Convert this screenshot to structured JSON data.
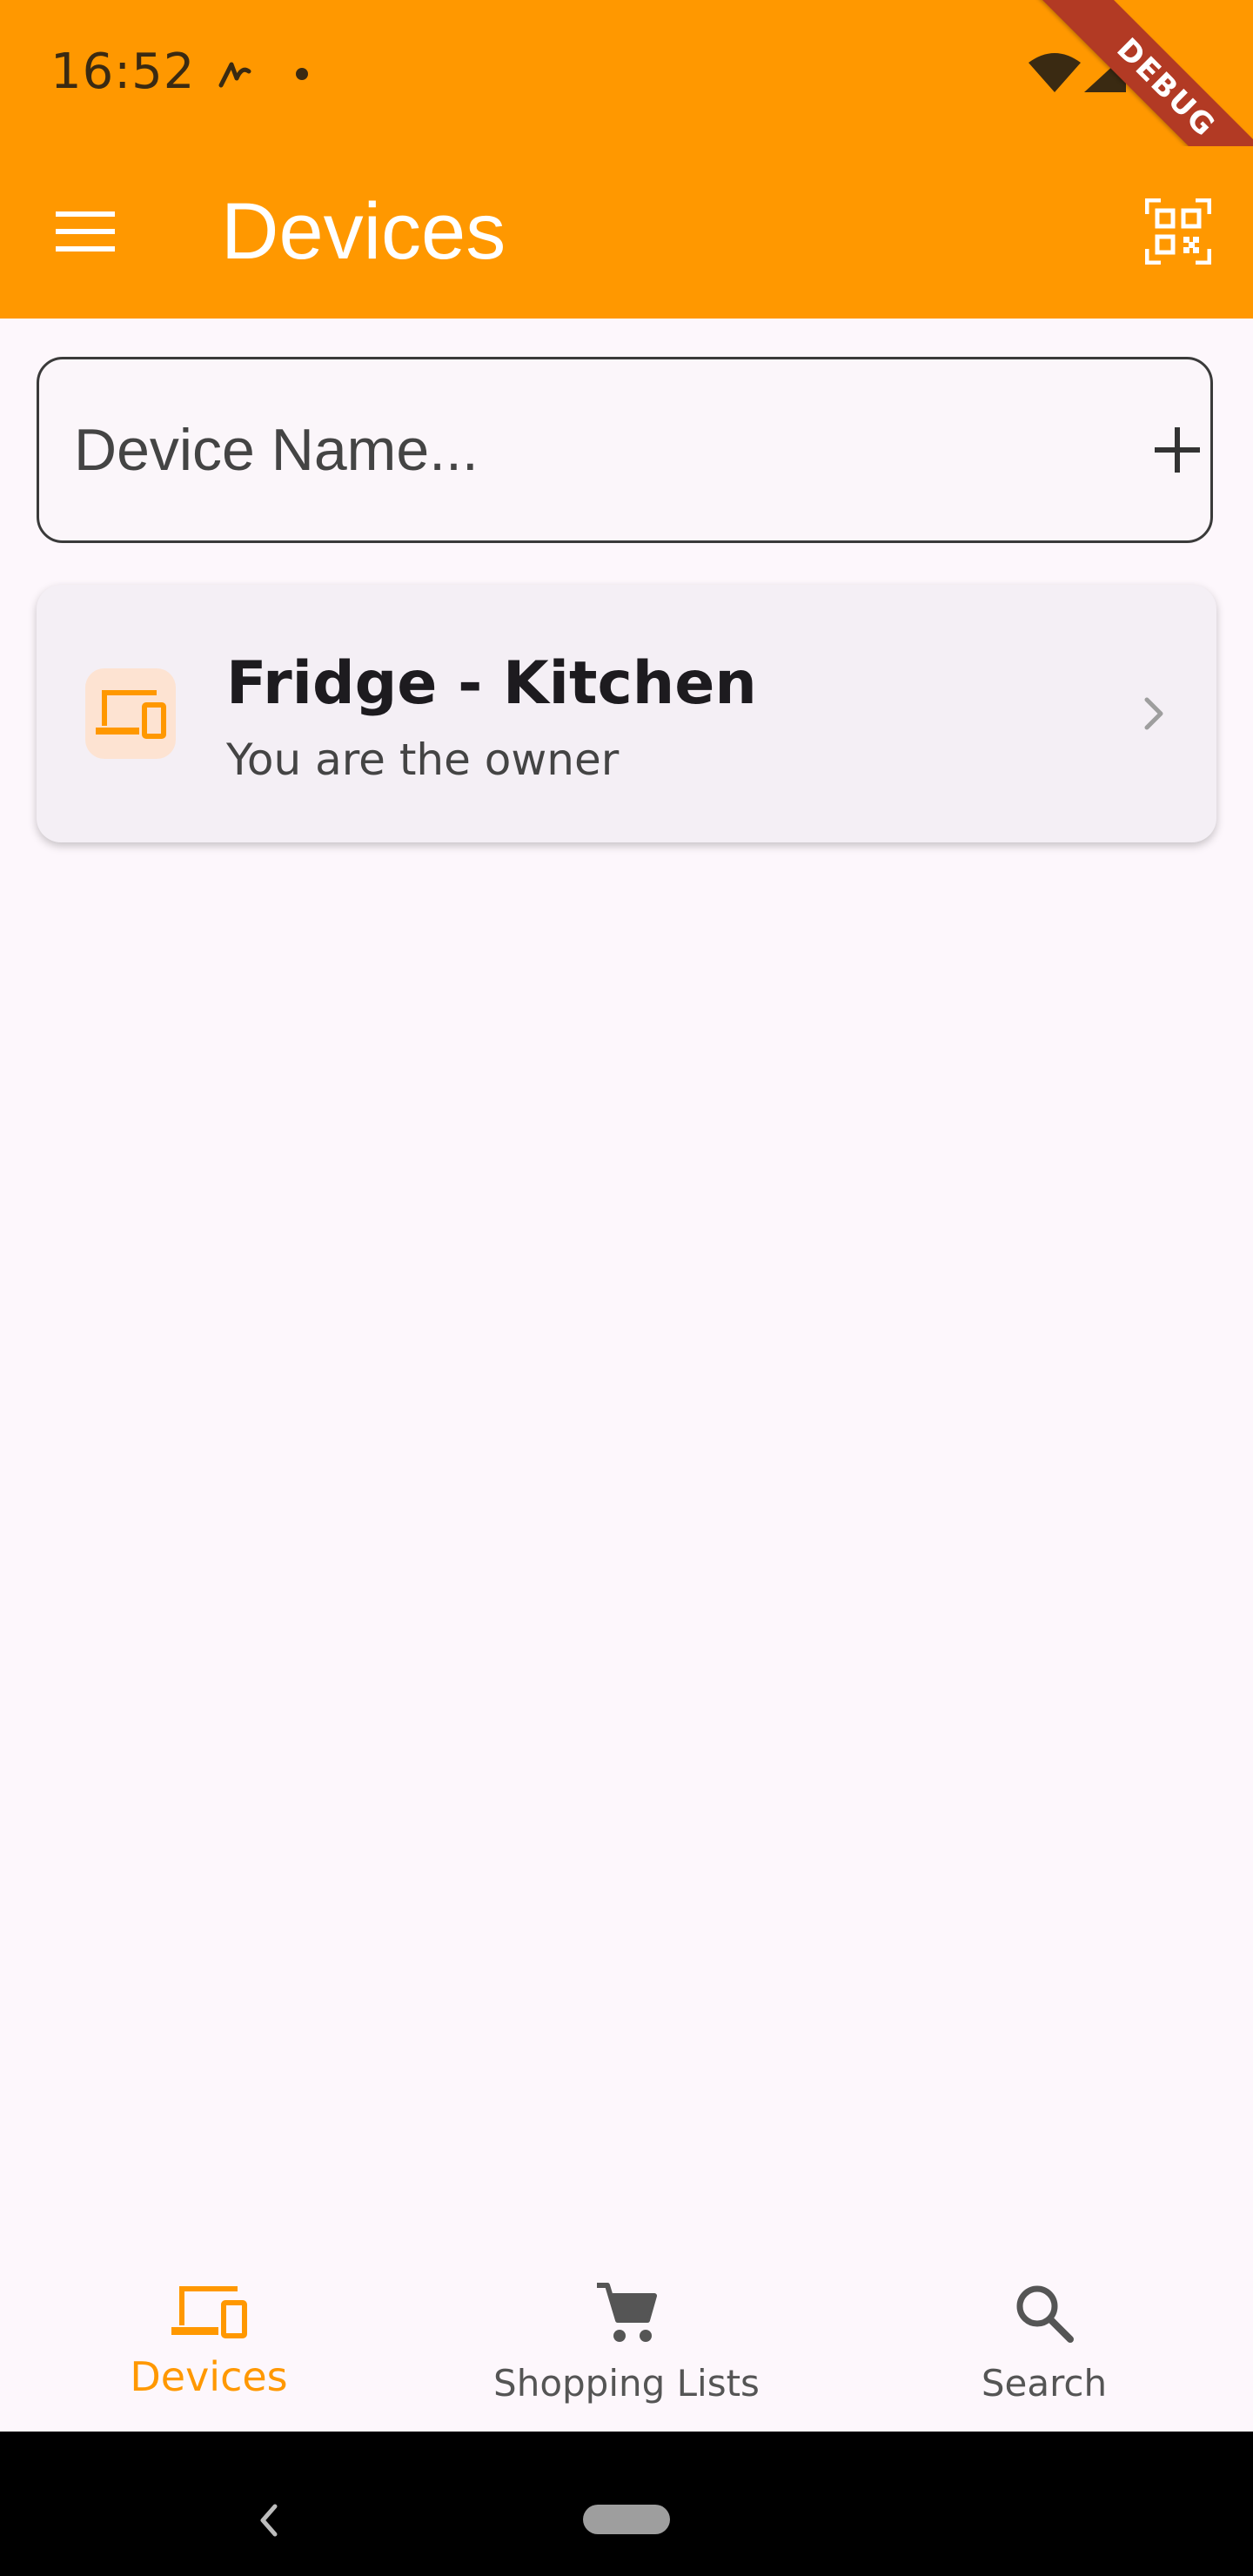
{
  "status_bar": {
    "time": "16:52",
    "icons": [
      "app-notification-icon",
      "dot-icon",
      "wifi-icon",
      "signal-icon",
      "battery-icon"
    ]
  },
  "debug_banner": "DEBUG",
  "app_bar": {
    "title": "Devices",
    "menu_icon": "menu-icon",
    "action_icon": "qr-code-scanner-icon"
  },
  "device_input": {
    "placeholder": "Device Name...",
    "value": "",
    "action_icon": "plus-icon"
  },
  "devices": [
    {
      "title": "Fridge - Kitchen",
      "subtitle": "You are the owner",
      "icon": "devices-icon",
      "trailing_icon": "chevron-right-icon"
    }
  ],
  "bottom_nav": {
    "items": [
      {
        "label": "Devices",
        "icon": "devices-icon",
        "active": true
      },
      {
        "label": "Shopping Lists",
        "icon": "shopping-cart-icon",
        "active": false
      },
      {
        "label": "Search",
        "icon": "search-icon",
        "active": false
      }
    ]
  },
  "colors": {
    "primary": "#ff9800",
    "background": "#fdf7fc",
    "card": "#f4eff5",
    "text_dark": "#1d1b1f",
    "ribbon": "#b23a24"
  }
}
